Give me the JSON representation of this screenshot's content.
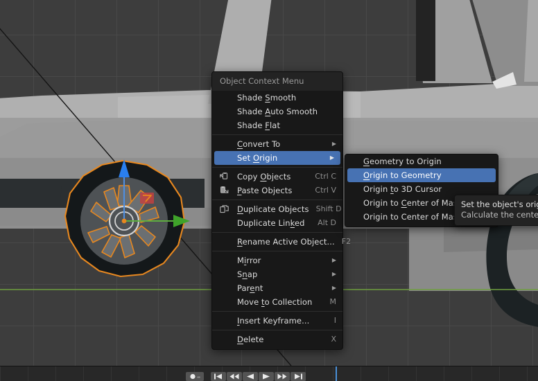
{
  "viewport": {
    "name": "3d-viewport",
    "background_color": "#3d3d3d",
    "grid_color": "#494949",
    "axis_y_line_color": "#6f9e3f",
    "selection_outline_color": "#e8881f",
    "gizmo": {
      "z_arrow_color": "#2a7fee",
      "y_arrow_color": "#3fa32a",
      "x_handle_color": "#c64040",
      "origin_dot_color": "#e8881f"
    },
    "objects": [
      {
        "label": "wheel-tire",
        "selected": true
      },
      {
        "label": "vehicle-body",
        "selected": false
      },
      {
        "label": "rear-tire",
        "selected": false
      }
    ]
  },
  "timeline": {
    "name": "timeline-editor",
    "playhead_color": "#4a90d9",
    "transport_buttons": [
      {
        "icon": "record-icon",
        "label": "Record"
      },
      {
        "icon": "auto-key-icon",
        "label": "Auto Keying"
      },
      {
        "icon": "jump-to-start-icon",
        "label": "Jump to Start"
      },
      {
        "icon": "previous-keyframe-icon",
        "label": "Previous Keyframe"
      },
      {
        "icon": "play-reverse-icon",
        "label": "Play Reverse"
      },
      {
        "icon": "play-icon",
        "label": "Play"
      },
      {
        "icon": "next-keyframe-icon",
        "label": "Next Keyframe"
      },
      {
        "icon": "jump-to-end-icon",
        "label": "Jump to End"
      }
    ]
  },
  "context_menu": {
    "title": "Object Context Menu",
    "highlight_color": "#4772b3",
    "background_color": "#181818",
    "items": [
      {
        "label": "Shade Smooth",
        "icon": null,
        "shortcut": "",
        "submenu": false,
        "highlight": false,
        "underline": 6
      },
      {
        "label": "Shade Auto Smooth",
        "icon": null,
        "shortcut": "",
        "submenu": false,
        "highlight": false,
        "underline": 6
      },
      {
        "label": "Shade Flat",
        "icon": null,
        "shortcut": "",
        "submenu": false,
        "highlight": false,
        "underline": 6
      },
      {
        "separator": true
      },
      {
        "label": "Convert To",
        "icon": null,
        "shortcut": "",
        "submenu": true,
        "highlight": false,
        "underline": 0
      },
      {
        "label": "Set Origin",
        "icon": null,
        "shortcut": "",
        "submenu": true,
        "highlight": true,
        "underline": 4
      },
      {
        "separator": true
      },
      {
        "label": "Copy Objects",
        "icon": "copy-icon",
        "shortcut": "Ctrl C",
        "submenu": false,
        "highlight": false,
        "underline": 5
      },
      {
        "label": "Paste Objects",
        "icon": "paste-icon",
        "shortcut": "Ctrl V",
        "submenu": false,
        "highlight": false,
        "underline": 0
      },
      {
        "separator": true
      },
      {
        "label": "Duplicate Objects",
        "icon": "duplicate-icon",
        "shortcut": "Shift D",
        "submenu": false,
        "highlight": false,
        "underline": 0
      },
      {
        "label": "Duplicate Linked",
        "icon": null,
        "shortcut": "Alt D",
        "submenu": false,
        "highlight": false,
        "underline": 13
      },
      {
        "separator": true
      },
      {
        "label": "Rename Active Object...",
        "icon": null,
        "shortcut": "F2",
        "submenu": false,
        "highlight": false,
        "underline": 0
      },
      {
        "separator": true
      },
      {
        "label": "Mirror",
        "icon": null,
        "shortcut": "",
        "submenu": true,
        "highlight": false,
        "underline": 1
      },
      {
        "label": "Snap",
        "icon": null,
        "shortcut": "",
        "submenu": true,
        "highlight": false,
        "underline": 1
      },
      {
        "label": "Parent",
        "icon": null,
        "shortcut": "",
        "submenu": true,
        "highlight": false,
        "underline": 3
      },
      {
        "label": "Move to Collection",
        "icon": null,
        "shortcut": "M",
        "submenu": false,
        "highlight": false,
        "underline": 5
      },
      {
        "separator": true
      },
      {
        "label": "Insert Keyframe...",
        "icon": null,
        "shortcut": "I",
        "submenu": false,
        "highlight": false,
        "underline": 0
      },
      {
        "separator": true
      },
      {
        "label": "Delete",
        "icon": null,
        "shortcut": "X",
        "submenu": false,
        "highlight": false,
        "underline": 0
      }
    ]
  },
  "submenu": {
    "name": "set-origin-submenu",
    "items": [
      {
        "label": "Geometry to Origin",
        "highlight": false,
        "underline": 0
      },
      {
        "label": "Origin to Geometry",
        "highlight": true,
        "underline": 0
      },
      {
        "label": "Origin to 3D Cursor",
        "highlight": false,
        "underline": 7
      },
      {
        "label": "Origin to Center of Mass (Surface)",
        "highlight": false,
        "underline": 10
      },
      {
        "label": "Origin to Center of Mass (Volume)",
        "highlight": false,
        "underline": 23
      }
    ]
  },
  "tooltip": {
    "name": "origin-to-geometry-tooltip",
    "line1": "Set the object's origin,",
    "line2": "Calculate the center of"
  }
}
